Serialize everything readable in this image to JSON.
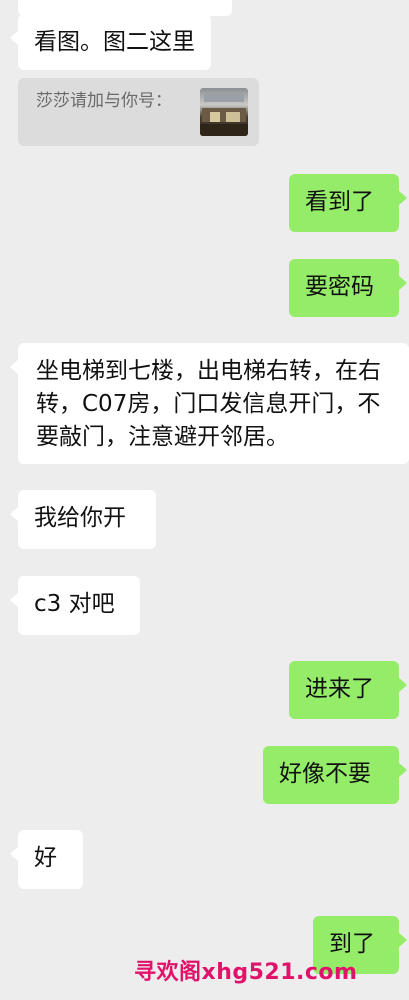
{
  "messages": [
    {
      "side": "in",
      "text": "看图。图二这里"
    },
    {
      "side": "quote",
      "text": "莎莎请加与你号："
    },
    {
      "side": "out",
      "text": "看到了"
    },
    {
      "side": "out",
      "text": "要密码"
    },
    {
      "side": "in",
      "text": "坐电梯到七楼，出电梯右转，在右转，C07房，门口发信息开门，不要敲门，注意避开邻居。"
    },
    {
      "side": "in",
      "text": "我给你开"
    },
    {
      "side": "in",
      "text": "c3 对吧"
    },
    {
      "side": "out",
      "text": "进来了"
    },
    {
      "side": "out",
      "text": "好像不要"
    },
    {
      "side": "in",
      "text": "好"
    },
    {
      "side": "out",
      "text": "到了"
    }
  ],
  "quote_thumbnail_icon": "building-photo-thumbnail",
  "watermark": "寻欢阁xhg521.com",
  "colors": {
    "background": "#ededed",
    "incoming_bubble": "#ffffff",
    "outgoing_bubble": "#95ec69",
    "quote_bubble": "#dcdcdc",
    "watermark": "#e0126a"
  }
}
